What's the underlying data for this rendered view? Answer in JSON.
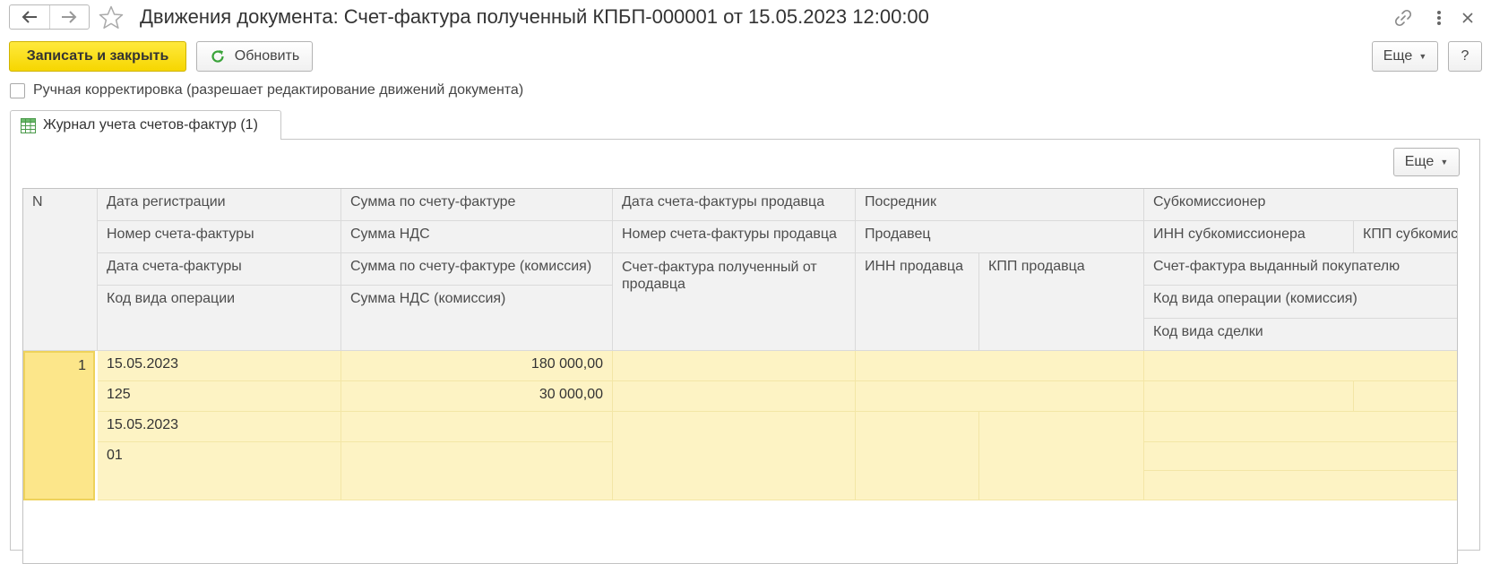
{
  "window": {
    "title": "Движения документа: Счет-фактура полученный КПБП-000001 от 15.05.2023 12:00:00",
    "icons": {
      "back": "arrow-left-icon",
      "forward": "arrow-right-icon",
      "favorite": "star-icon",
      "link": "link-icon",
      "more": "more-vertical-icon",
      "close": "close-icon"
    }
  },
  "toolbar": {
    "save_close": "Записать и закрыть",
    "refresh": "Обновить",
    "more": "Еще",
    "help": "?"
  },
  "manual_correction": {
    "label": "Ручная корректировка (разрешает редактирование движений документа)",
    "checked": false
  },
  "tab": {
    "label": "Журнал учета счетов-фактур (1)",
    "icon": "table-icon"
  },
  "grid": {
    "more": "Еще",
    "headers": {
      "n": "N",
      "reg_date": "Дата регистрации",
      "invoice_number": "Номер счета-фактуры",
      "invoice_date": "Дата счета-фактуры",
      "operation_code": "Код вида операции",
      "invoice_sum": "Сумма по счету-фактуре",
      "vat_sum": "Сумма НДС",
      "invoice_sum_commission": "Сумма по счету-фактуре (комиссия)",
      "vat_sum_commission": "Сумма НДС (комиссия)",
      "seller_invoice_date": "Дата счета-фактуры продавца",
      "seller_invoice_number": "Номер счета-фактуры продавца",
      "invoice_from_seller": "Счет-фактура полученный от продавца",
      "intermediary": "Посредник",
      "seller": "Продавец",
      "seller_inn": "ИНН продавца",
      "seller_kpp": "КПП продавца",
      "subcommissioner": "Субкомиссионер",
      "subcommissioner_inn": "ИНН субкомиссионера",
      "subcommissioner_kpp": "КПП субкомис",
      "invoice_issued_to_buyer": "Счет-фактура выданный покупателю",
      "operation_code_commission": "Код вида операции (комиссия)",
      "deal_code": "Код вида сделки"
    },
    "row": {
      "n": "1",
      "reg_date": "15.05.2023",
      "invoice_number": "125",
      "invoice_date": "15.05.2023",
      "operation_code": "01",
      "invoice_sum": "180 000,00",
      "vat_sum": "30 000,00"
    }
  }
}
